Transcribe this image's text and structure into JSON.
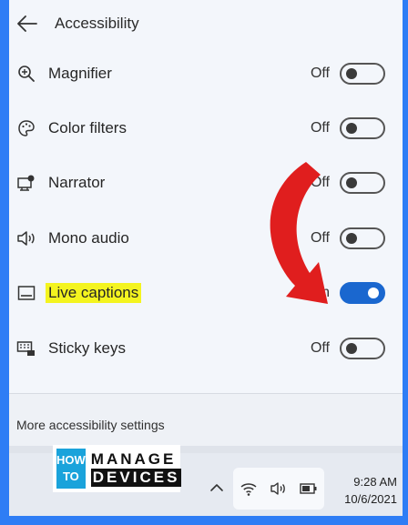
{
  "header": {
    "title": "Accessibility"
  },
  "rows": [
    {
      "id": "magnifier",
      "label": "Magnifier",
      "state": "Off",
      "on": false,
      "icon": "magnifier-icon"
    },
    {
      "id": "color-filters",
      "label": "Color filters",
      "state": "Off",
      "on": false,
      "icon": "color-filters-icon"
    },
    {
      "id": "narrator",
      "label": "Narrator",
      "state": "Off",
      "on": false,
      "icon": "narrator-icon"
    },
    {
      "id": "mono-audio",
      "label": "Mono audio",
      "state": "Off",
      "on": false,
      "icon": "speaker-icon"
    },
    {
      "id": "live-captions",
      "label": "Live captions",
      "state": "On",
      "on": true,
      "icon": "captions-icon"
    },
    {
      "id": "sticky-keys",
      "label": "Sticky keys",
      "state": "Off",
      "on": false,
      "icon": "keyboard-icon"
    }
  ],
  "footer": {
    "link": "More accessibility settings"
  },
  "logo": {
    "how": "HOW",
    "to": "TO",
    "manage": "MANAGE",
    "devices": "DEVICES"
  },
  "taskbar": {
    "time": "9:28 AM",
    "date": "10/6/2021"
  },
  "colors": {
    "accent": "#1a67cf",
    "highlight": "#f4f41f",
    "arrow": "#e01e1e",
    "border": "#2e7df5"
  }
}
